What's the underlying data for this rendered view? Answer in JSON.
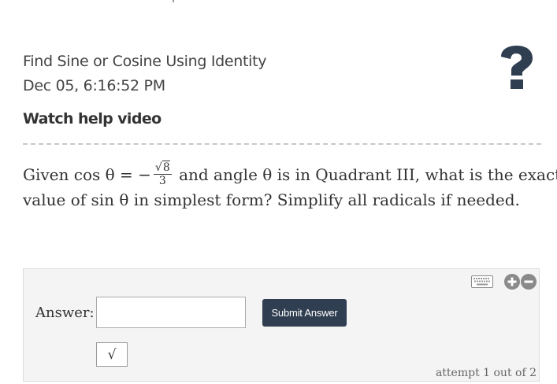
{
  "header": {
    "title": "Find Sine or Cosine Using Identity",
    "date": "Dec 05, 6:16:52 PM",
    "help_link": "Watch help video",
    "help_icon": "question-mark-icon"
  },
  "question": {
    "given": "Given cos θ = −",
    "frac_num_radicand": "8",
    "frac_den": "3",
    "rest_line1": "and angle θ is in Quadrant III, what is the exact",
    "line2": "value of sin θ in simplest form? Simplify all radicals if needed."
  },
  "answer": {
    "label": "Answer:",
    "input_value": "",
    "submit_label": "Submit Answer",
    "sqrt_button": "√",
    "attempt_text": "attempt 1 out of 2"
  },
  "icons": {
    "keyboard": "keyboard-icon",
    "zoom_in": "plus-icon",
    "zoom_out": "minus-icon"
  },
  "colors": {
    "submit_bg": "#2f3e50",
    "panel_bg": "#f4f4f4",
    "text": "#333333"
  }
}
